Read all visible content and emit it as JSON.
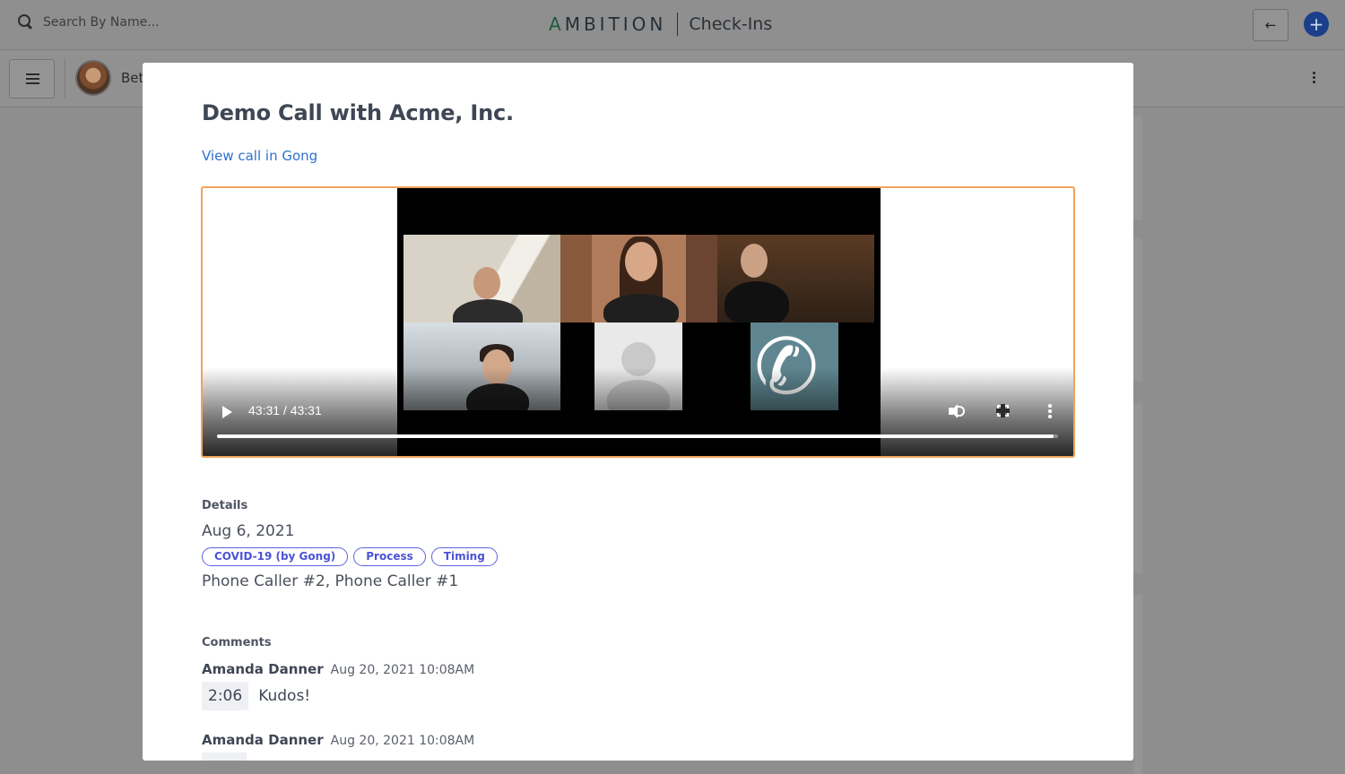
{
  "topbar": {
    "search_placeholder": "Search By Name...",
    "brand_first": "A",
    "brand_rest": "MBITION",
    "brand_section": "Check-Ins",
    "back_label": "←",
    "add_label": "+"
  },
  "subbar": {
    "user_name": "Bet"
  },
  "modal": {
    "title": "Demo Call with Acme, Inc.",
    "gong_link": "View call in Gong",
    "video": {
      "time_display": "43:31 / 43:31",
      "progress_fraction": 0.995
    },
    "details_label": "Details",
    "date": "Aug 6, 2021",
    "tags": [
      "COVID-19 (by Gong)",
      "Process",
      "Timing"
    ],
    "participants": "Phone Caller #2, Phone Caller #1",
    "comments_label": "Comments",
    "comments": [
      {
        "author": "Amanda Danner",
        "time": "Aug 20, 2021 10:08AM",
        "timestamp": "2:06",
        "text": "Kudos!"
      },
      {
        "author": "Amanda Danner",
        "time": "Aug 20, 2021 10:08AM"
      }
    ]
  },
  "colors": {
    "accent": "#2f6fd0",
    "tag": "#5b63e0",
    "video_border": "#f0a35a"
  }
}
